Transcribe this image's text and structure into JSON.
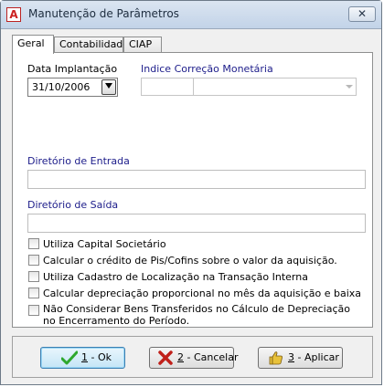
{
  "window": {
    "title": "Manutenção de Parâmetros",
    "close_symbol": "✕",
    "icon": "app-logo-icon",
    "icon_letter": "A"
  },
  "tabs": [
    {
      "label": "Geral",
      "active": true
    },
    {
      "label": "Contabilidade",
      "active": false
    },
    {
      "label": "CIAP",
      "active": false
    }
  ],
  "form": {
    "data_implantacao_label": "Data Implantação",
    "data_implantacao_value": "31/10/2006",
    "indice_label": "Indice Correção Monetária",
    "indice_code": "",
    "indice_desc": "",
    "diretorio_entrada_label": "Diretório de Entrada",
    "diretorio_entrada_value": "",
    "diretorio_saida_label": "Diretório de Saída",
    "diretorio_saida_value": ""
  },
  "checkboxes": [
    {
      "label": "Utiliza Capital Societário",
      "checked": false
    },
    {
      "label": "Calcular o crédito de Pis/Cofins sobre o valor da aquisição.",
      "checked": false
    },
    {
      "label": "Utiliza Cadastro de Localização na Transação Interna",
      "checked": false
    },
    {
      "label": "Calcular depreciação proporcional no mês da aquisição e baixa",
      "checked": false
    },
    {
      "label_line1": "Não Considerar Bens Transferidos no Cálculo de Depreciação",
      "label_line2": "no Encerramento do Período.",
      "checked": false
    }
  ],
  "buttons": {
    "ok": {
      "key": "1",
      "label": " - Ok",
      "icon": "checkmark-icon"
    },
    "cancel": {
      "key": "2",
      "label": " - Cancelar",
      "icon": "x-cancel-icon"
    },
    "apply": {
      "key": "3",
      "label": " - Aplicar",
      "icon": "thumbs-up-icon"
    }
  },
  "colors": {
    "label_blue": "#1c1c8a",
    "default_button_border": "#3c7fb1",
    "ok_check": "#2ea82e",
    "cancel_x": "#c0201a",
    "thumb": "#e8c23a"
  }
}
